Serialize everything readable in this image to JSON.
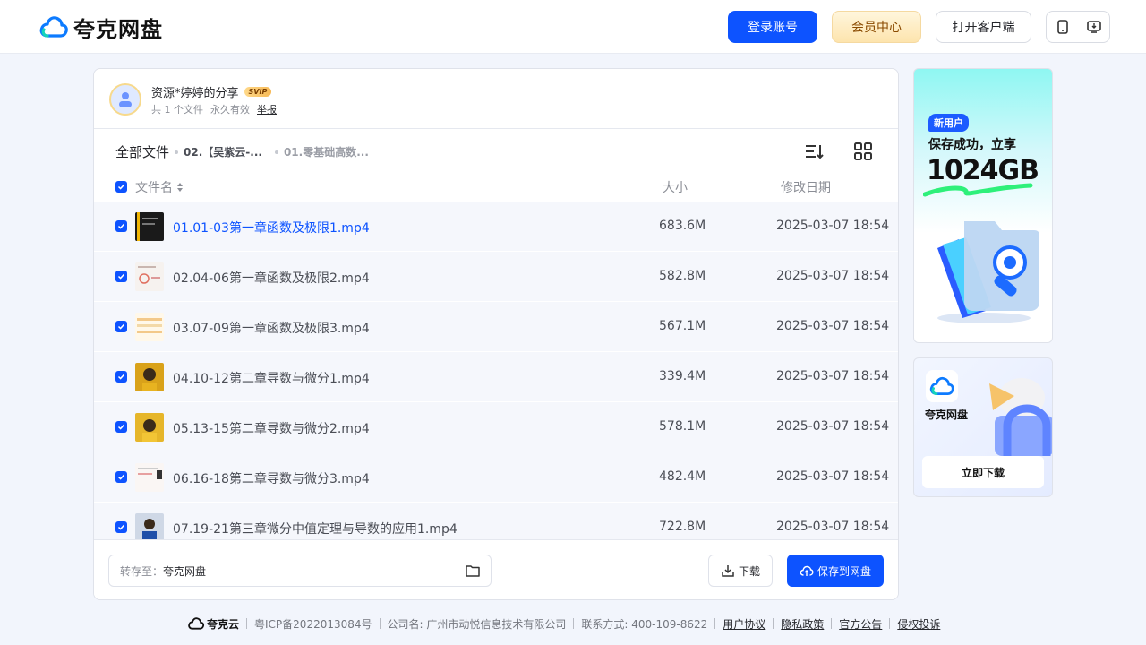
{
  "header": {
    "logo_text": "夸克网盘",
    "login_label": "登录账号",
    "vip_label": "会员中心",
    "client_label": "打开客户端",
    "colors": {
      "primary": "#0d53ff",
      "vip_text": "#8a4a00"
    }
  },
  "share": {
    "owner": "资源*婷婷的分享",
    "badge": "SVIP",
    "file_count": "共 1 个文件",
    "validity": "永久有效",
    "report": "举报"
  },
  "breadcrumb": {
    "root": "全部文件",
    "items": [
      "02.【吴紫云-...",
      "01.零基础高数..."
    ]
  },
  "table": {
    "col_name": "文件名",
    "col_size": "大小",
    "col_date": "修改日期",
    "rows": [
      {
        "name": "01.01-03第一章函数及极限1.mp4",
        "size": "683.6M",
        "date": "2025-03-07 18:54",
        "active": true
      },
      {
        "name": "02.04-06第一章函数及极限2.mp4",
        "size": "582.8M",
        "date": "2025-03-07 18:54"
      },
      {
        "name": "03.07-09第一章函数及极限3.mp4",
        "size": "567.1M",
        "date": "2025-03-07 18:54"
      },
      {
        "name": "04.10-12第二章导数与微分1.mp4",
        "size": "339.4M",
        "date": "2025-03-07 18:54"
      },
      {
        "name": "05.13-15第二章导数与微分2.mp4",
        "size": "578.1M",
        "date": "2025-03-07 18:54"
      },
      {
        "name": "06.16-18第二章导数与微分3.mp4",
        "size": "482.4M",
        "date": "2025-03-07 18:54"
      },
      {
        "name": "07.19-21第三章微分中值定理与导数的应用1.mp4",
        "size": "722.8M",
        "date": "2025-03-07 18:54"
      }
    ]
  },
  "actions": {
    "save_to_label": "转存至：",
    "save_to_value": "夸克网盘",
    "download_label": "下载",
    "save_label": "保存到网盘"
  },
  "ads": {
    "ad1_badge": "新用户",
    "ad1_line": "保存成功，立享",
    "ad1_big": "1024GB",
    "ad2_name": "夸克网盘",
    "ad2_button": "立即下载"
  },
  "footer": {
    "brand": "夸克云",
    "icp": "粤ICP备2022013084号",
    "company": "公司名: 广州市动悦信息技术有限公司",
    "contact": "联系方式: 400-109-8622",
    "links": [
      "用户协议",
      "隐私政策",
      "官方公告",
      "侵权投诉"
    ]
  }
}
